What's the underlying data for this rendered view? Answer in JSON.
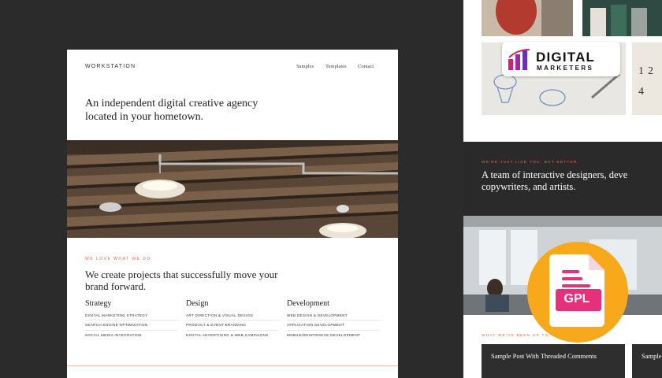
{
  "left_preview": {
    "brand": "WORKSTATION",
    "nav": [
      "Samples",
      "Templates",
      "Contact"
    ],
    "hero_title": "An independent digital creative agency located in your hometown.",
    "section_label": "WE LOVE WHAT WE DO",
    "headline": "We create projects that successfully move your brand forward.",
    "columns": [
      {
        "title": "Strategy",
        "items": [
          "DIGITAL MARKETING STRATEGY",
          "SEARCH ENGINE OPTIMIZATION",
          "SOCIAL MEDIA INTEGRATION"
        ]
      },
      {
        "title": "Design",
        "items": [
          "ART DIRECTION & VISUAL DESIGN",
          "PRODUCT & EVENT BRANDING",
          "DIGITAL ADVERTISING & WEB CAMPAIGNS"
        ]
      },
      {
        "title": "Development",
        "items": [
          "WEB DESIGN & DEVELOPMENT",
          "APPLICATION DEVELOPMENT",
          "MOBILE/RESPONSIVE DEVELOPMENT"
        ]
      }
    ]
  },
  "right_preview": {
    "tagline_label": "WE'RE JUST LIKE YOU, BUT BETTER",
    "tagline": "A team of interactive designers, developers, copywriters, and artists.",
    "tagline_line1": "A team of interactive designers, deve",
    "tagline_line2": "copywriters, and artists.",
    "recent_label": "WHAT WE'VE BEEN UP TO",
    "posts": [
      "Sample Post With Threaded Comments",
      "Sample"
    ]
  },
  "badges": {
    "logo_line1": "DIGITAL",
    "logo_line2": "MARKETERS",
    "license": "GPL",
    "license_color": "#f7a81b",
    "accent_color": "#e06a4c"
  }
}
